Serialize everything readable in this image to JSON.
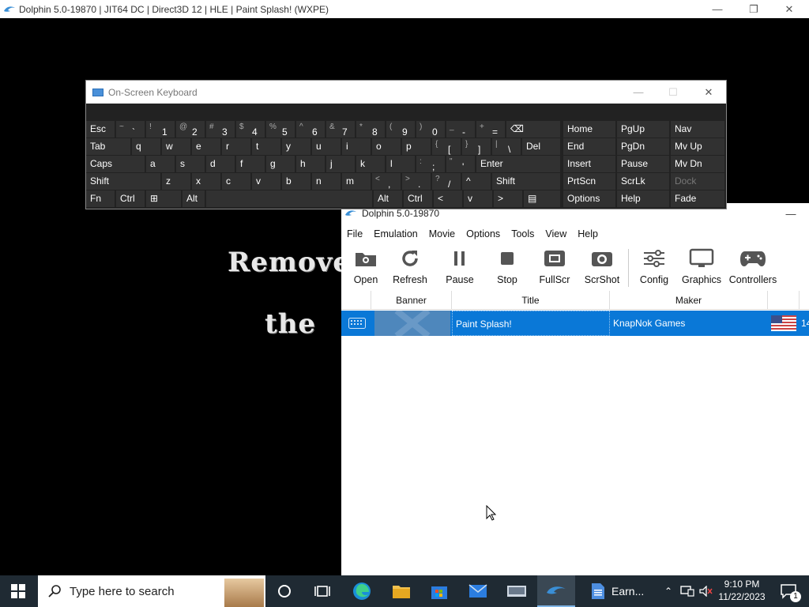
{
  "game_window": {
    "title": "Dolphin 5.0-19870 | JIT64 DC | Direct3D 12 | HLE | Paint Splash! (WXPE)",
    "controls": {
      "minimize": "—",
      "restore": "❐",
      "close": "✕"
    },
    "screen_text": {
      "line1": "Remove",
      "line2": "the"
    }
  },
  "osk": {
    "title": "On-Screen Keyboard",
    "rows": {
      "row1": [
        {
          "main": "Esc"
        },
        {
          "shift": "~",
          "main": "`"
        },
        {
          "shift": "!",
          "main": "1"
        },
        {
          "shift": "@",
          "main": "2"
        },
        {
          "shift": "#",
          "main": "3"
        },
        {
          "shift": "$",
          "main": "4"
        },
        {
          "shift": "%",
          "main": "5"
        },
        {
          "shift": "^",
          "main": "6"
        },
        {
          "shift": "&",
          "main": "7"
        },
        {
          "shift": "*",
          "main": "8"
        },
        {
          "shift": "(",
          "main": "9"
        },
        {
          "shift": ")",
          "main": "0"
        },
        {
          "shift": "_",
          "main": "-"
        },
        {
          "shift": "+",
          "main": "="
        },
        {
          "main": "⌫"
        }
      ],
      "row2": [
        {
          "main": "Tab"
        },
        {
          "main": "q"
        },
        {
          "main": "w"
        },
        {
          "main": "e"
        },
        {
          "main": "r"
        },
        {
          "main": "t"
        },
        {
          "main": "y"
        },
        {
          "main": "u"
        },
        {
          "main": "i"
        },
        {
          "main": "o"
        },
        {
          "main": "p"
        },
        {
          "shift": "{",
          "main": "["
        },
        {
          "shift": "}",
          "main": "]"
        },
        {
          "shift": "|",
          "main": "\\"
        },
        {
          "main": "Del"
        }
      ],
      "row3": [
        {
          "main": "Caps"
        },
        {
          "main": "a"
        },
        {
          "main": "s"
        },
        {
          "main": "d"
        },
        {
          "main": "f"
        },
        {
          "main": "g"
        },
        {
          "main": "h"
        },
        {
          "main": "j"
        },
        {
          "main": "k"
        },
        {
          "main": "l"
        },
        {
          "shift": ":",
          "main": ";"
        },
        {
          "shift": "\"",
          "main": "'"
        },
        {
          "main": "Enter"
        }
      ],
      "row4": [
        {
          "main": "Shift"
        },
        {
          "main": "z"
        },
        {
          "main": "x"
        },
        {
          "main": "c"
        },
        {
          "main": "v"
        },
        {
          "main": "b"
        },
        {
          "main": "n"
        },
        {
          "main": "m"
        },
        {
          "shift": "<",
          "main": ","
        },
        {
          "shift": ">",
          "main": "."
        },
        {
          "shift": "?",
          "main": "/"
        },
        {
          "main": "^"
        },
        {
          "main": "Shift"
        }
      ],
      "row5": [
        {
          "main": "Fn"
        },
        {
          "main": "Ctrl"
        },
        {
          "main": "⊞"
        },
        {
          "main": "Alt"
        },
        {
          "main": ""
        },
        {
          "main": "Alt"
        },
        {
          "main": "Ctrl"
        },
        {
          "main": "<"
        },
        {
          "main": "v"
        },
        {
          "main": ">"
        },
        {
          "main": "▤"
        }
      ]
    },
    "nav_keys": [
      [
        "Home",
        "PgUp",
        "Nav"
      ],
      [
        "End",
        "PgDn",
        "Mv Up"
      ],
      [
        "Insert",
        "Pause",
        "Mv Dn"
      ],
      [
        "PrtScn",
        "ScrLk",
        "Dock"
      ],
      [
        "Options",
        "Help",
        "Fade"
      ]
    ]
  },
  "dolphin": {
    "title": "Dolphin 5.0-19870",
    "menu": [
      "File",
      "Emulation",
      "Movie",
      "Options",
      "Tools",
      "View",
      "Help"
    ],
    "toolbar": [
      {
        "label": "Open",
        "icon": "folder-camera-icon"
      },
      {
        "label": "Refresh",
        "icon": "refresh-icon"
      },
      {
        "label": "Pause",
        "icon": "pause-icon"
      },
      {
        "label": "Stop",
        "icon": "stop-icon"
      },
      {
        "label": "FullScr",
        "icon": "fullscreen-icon"
      },
      {
        "label": "ScrShot",
        "icon": "camera-icon"
      },
      {
        "label": "Config",
        "icon": "sliders-icon"
      },
      {
        "label": "Graphics",
        "icon": "monitor-icon"
      },
      {
        "label": "Controllers",
        "icon": "gamepad-icon"
      }
    ],
    "columns": [
      "Banner",
      "Title",
      "Maker"
    ],
    "games": [
      {
        "title": "Paint Splash!",
        "maker": "KnapNok Games",
        "region": "14"
      }
    ]
  },
  "taskbar": {
    "search_placeholder": "Type here to search",
    "app_label": "Earn...",
    "time": "9:10 PM",
    "date": "11/22/2023",
    "notif_count": "1"
  },
  "colors": {
    "selection": "#0a78d7",
    "taskbar": "#1f2a33",
    "osk_key": "#313131"
  }
}
